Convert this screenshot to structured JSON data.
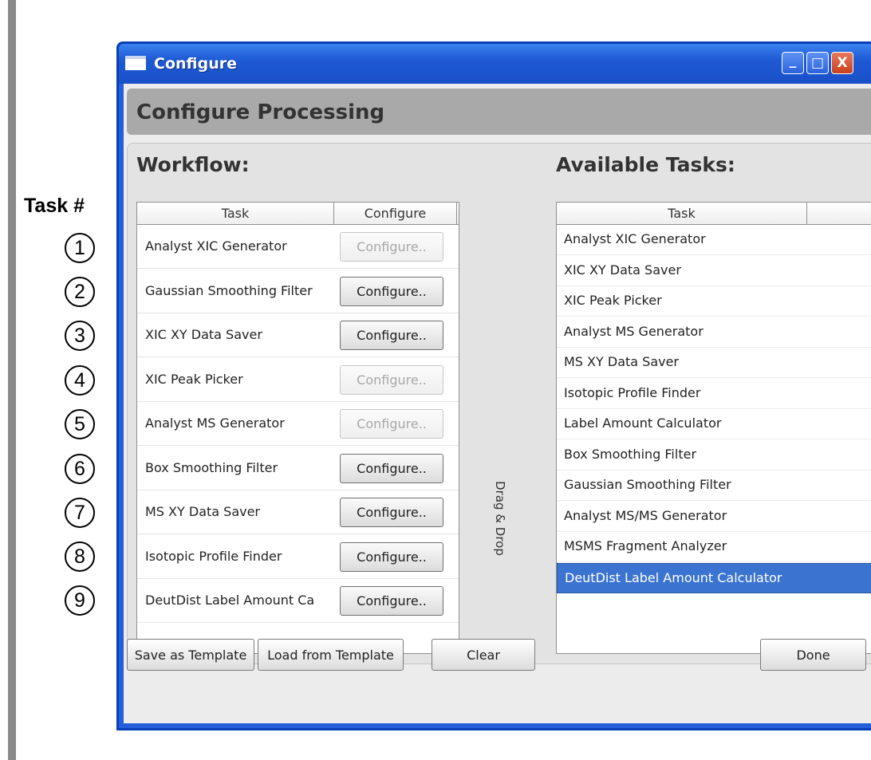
{
  "annotation": {
    "title": "Task #",
    "numbers": [
      "1",
      "2",
      "3",
      "4",
      "5",
      "6",
      "7",
      "8",
      "9"
    ]
  },
  "window": {
    "title": "Configure",
    "controls": {
      "minimize": "_",
      "maximize": "□",
      "close": "X"
    }
  },
  "header": {
    "title": "Configure Processing"
  },
  "workflow": {
    "heading": "Workflow:",
    "columns": [
      "Task",
      "Configure"
    ],
    "rows": [
      {
        "task": "Analyst XIC Generator",
        "button": "Configure..",
        "enabled": false
      },
      {
        "task": "Gaussian Smoothing Filter",
        "button": "Configure..",
        "enabled": true
      },
      {
        "task": "XIC XY Data Saver",
        "button": "Configure..",
        "enabled": true
      },
      {
        "task": "XIC Peak Picker",
        "button": "Configure..",
        "enabled": false
      },
      {
        "task": "Analyst MS Generator",
        "button": "Configure..",
        "enabled": false
      },
      {
        "task": "Box Smoothing Filter",
        "button": "Configure..",
        "enabled": true
      },
      {
        "task": "MS XY Data Saver",
        "button": "Configure..",
        "enabled": true
      },
      {
        "task": "Isotopic Profile Finder",
        "button": "Configure..",
        "enabled": true
      },
      {
        "task": "DeutDist Label Amount Ca",
        "button": "Configure..",
        "enabled": true
      }
    ]
  },
  "drag_drop": {
    "label": "Drag & Drop"
  },
  "available": {
    "heading": "Available Tasks:",
    "columns": [
      "Task",
      ""
    ],
    "items": [
      "Analyst XIC Generator",
      "XIC XY Data Saver",
      "XIC Peak Picker",
      "Analyst MS Generator",
      "MS XY Data Saver",
      "Isotopic Profile Finder",
      "Label Amount Calculator",
      "Box Smoothing Filter",
      "Gaussian Smoothing Filter",
      "Analyst MS/MS Generator",
      "MSMS Fragment Analyzer",
      "DeutDist Label Amount Calculator"
    ],
    "selected_index": 11
  },
  "buttons": {
    "save_template": "Save as Template",
    "load_template": "Load from Template",
    "clear": "Clear",
    "done": "Done"
  }
}
